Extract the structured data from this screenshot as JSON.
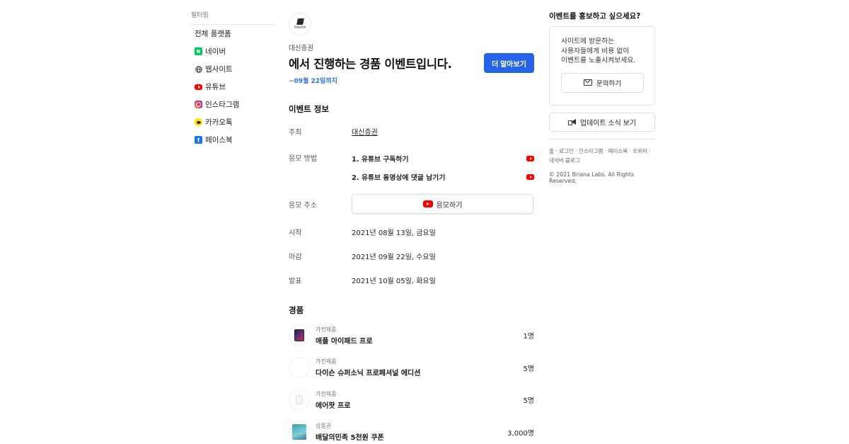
{
  "sidebar": {
    "title": "필터링",
    "items": [
      {
        "label": "전체 플랫폼",
        "icon": ""
      },
      {
        "label": "네이버",
        "icon": "naver-icon"
      },
      {
        "label": "웹사이트",
        "icon": "globe-icon"
      },
      {
        "label": "유튜브",
        "icon": "youtube-icon"
      },
      {
        "label": "인스타그램",
        "icon": "instagram-icon"
      },
      {
        "label": "카카오톡",
        "icon": "kakaotalk-icon"
      },
      {
        "label": "페이스북",
        "icon": "facebook-icon"
      }
    ]
  },
  "event": {
    "logo_text": "Daishin",
    "organizer": "대신증권",
    "headline": "에서 진행하는 경품 이벤트입니다.",
    "deadline": "~09월 22일까지",
    "learn_more": "더 알아보기"
  },
  "info": {
    "title": "이벤트 정보",
    "host_label": "주최",
    "host_value": "대신증권",
    "method_label": "응모 방법",
    "methods": [
      "1. 유튜브 구독하기",
      "2. 유튜브 동영상에 댓글 남기기"
    ],
    "address_label": "응모 주소",
    "apply_button": "응모하기",
    "start_label": "시작",
    "start_value": "2021년 08월 13일, 금요일",
    "end_label": "마감",
    "end_value": "2021년 09월 22일, 수요일",
    "announce_label": "발표",
    "announce_value": "2021년 10월 05일, 화요일"
  },
  "prizes": {
    "title": "경품",
    "items": [
      {
        "category": "가전제품",
        "name": "애플 아이패드 프로",
        "qty": "1명"
      },
      {
        "category": "가전제품",
        "name": "다이슨 슈퍼소닉 프로페셔널 에디션",
        "qty": "5명"
      },
      {
        "category": "가전제품",
        "name": "에어팟 프로",
        "qty": "5명"
      },
      {
        "category": "상품권",
        "name": "배달의민족 5천원 쿠폰",
        "qty": "3,000명"
      }
    ]
  },
  "promo": {
    "title": "이벤트를 홍보하고 싶으세요?",
    "line1": "사이트에 방문하는",
    "line2": "사용자들에게 비용 없이",
    "line3": "이벤트를 노출시켜보세요.",
    "inquiry_button": "문의하기",
    "update_button": "업데이트 소식 보기"
  },
  "footer": {
    "links": [
      "홈",
      "로그인",
      "인스타그램",
      "페이스북",
      "트위터",
      "네이버 블로그"
    ],
    "separator": "·",
    "copyright": "© 2021 Briana Labs. All Rights Reserved."
  },
  "colors": {
    "accent": "#2563eb",
    "deadline": "#2b6fe0",
    "youtube": "#ff0000",
    "naver": "#03c75a",
    "kakao": "#fee500",
    "facebook": "#1877f2"
  }
}
